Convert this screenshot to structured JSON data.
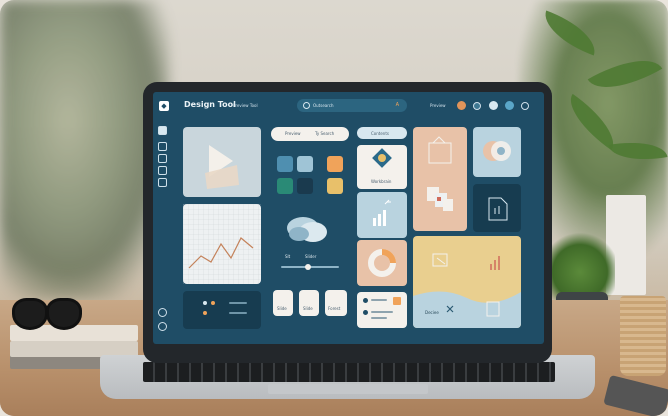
{
  "app": {
    "title": "Design Tool",
    "sub_label": "Preview Tool",
    "search_placeholder": "Outsearch",
    "search_badge": "A",
    "top_right_label": "Preview"
  },
  "panels": {
    "chip_label_1": "Preview",
    "chip_label_2": "Ty Search",
    "chip_label_3": "Contents",
    "card_word": "Workbrain",
    "slider_value": "Slt",
    "slider_text": "Slider",
    "button_1": "Slide",
    "button_2": "Slide",
    "button_3": "Forest",
    "bottom_label": "Deciee"
  },
  "colors": {
    "screen_bg": "#1f4d66",
    "accent_orange": "#f0a35a",
    "peach": "#e8c2a8",
    "light_blue": "#b9d3df",
    "sand": "#e9cf8f"
  }
}
